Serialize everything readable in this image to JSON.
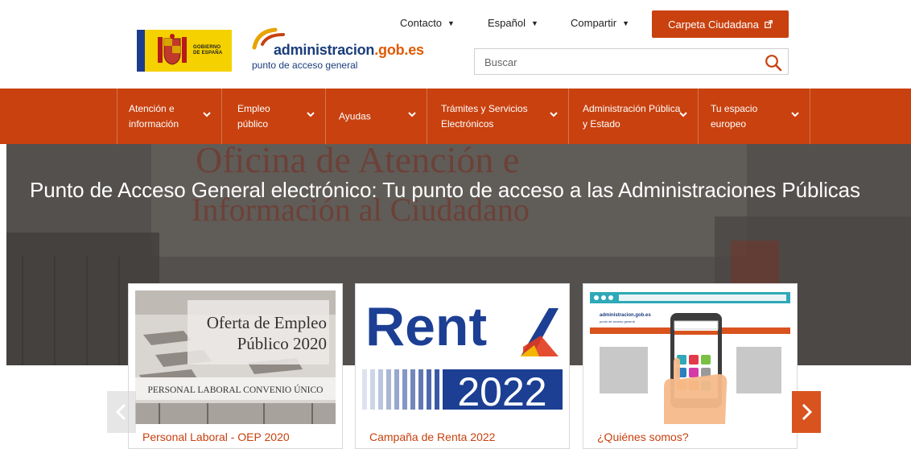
{
  "header": {
    "gob_logo_text": "GOBIERNO\nDE ESPAÑA",
    "site_domain_main": "administracion",
    "site_domain_suffix": ".gob.es",
    "site_tagline": "punto de acceso general",
    "links": {
      "contacto": "Contacto",
      "idioma": "Español",
      "compartir": "Compartir"
    },
    "carpeta_label": "Carpeta Ciudadana",
    "search_placeholder": "Buscar"
  },
  "nav": {
    "items": [
      {
        "label": "Atención e\ninformación"
      },
      {
        "label": "Empleo\npúblico"
      },
      {
        "label": "Ayudas"
      },
      {
        "label": "Trámites y Servicios\nElectrónicos"
      },
      {
        "label": "Administración Pública\ny Estado"
      },
      {
        "label": "Tu espacio\neuropeo"
      }
    ]
  },
  "hero": {
    "title": "Punto de Acceso General electrónico: Tu punto de acceso a las Administraciones Públicas",
    "background_text_1": "Oficina de Atención e",
    "background_text_2": "Información al Ciudadano"
  },
  "cards": [
    {
      "title": "Personal Laboral - OEP 2020",
      "image_text_1": "Oferta de Empleo",
      "image_text_2": "Público 2020",
      "image_caption": "PERSONAL LABORAL CONVENIO ÚNICO"
    },
    {
      "title": "Campaña de Renta 2022",
      "image_text_1": "Rent",
      "image_text_2": "2022"
    },
    {
      "title": "¿Quiénes somos?",
      "image_logo_text": "administracion.gob.es",
      "image_logo_tagline": "punto de acceso general"
    }
  ],
  "colors": {
    "brand": "#c8410f",
    "brand_dark": "#1a3d7c",
    "next_arrow": "#d9531e",
    "gob_yellow": "#f5d100"
  },
  "icons": {
    "caret": "caret-down-icon",
    "external": "external-link-icon",
    "search": "search-icon",
    "chevron": "chevron-down-icon",
    "prev": "chevron-left-icon",
    "next": "chevron-right-icon"
  }
}
